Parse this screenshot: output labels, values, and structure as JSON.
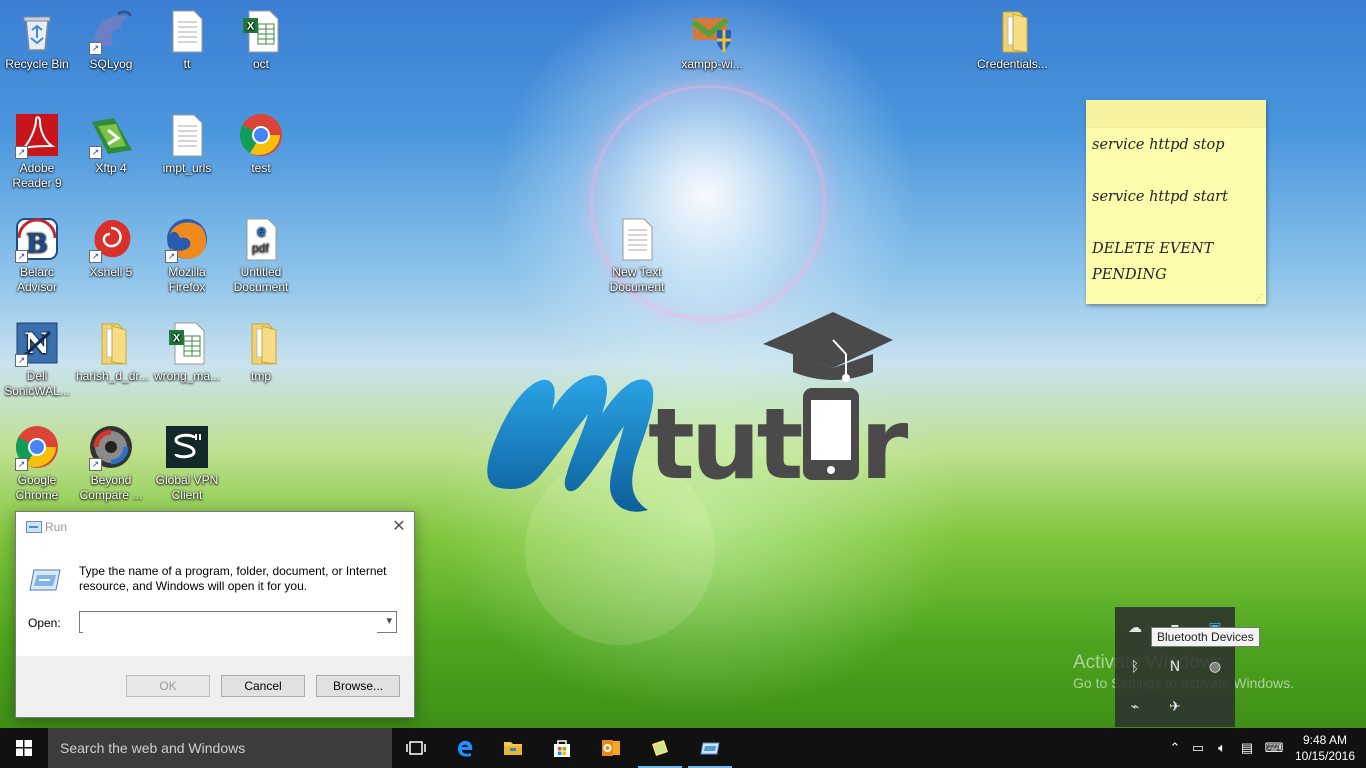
{
  "desktop_icons": [
    {
      "label": "Recycle Bin",
      "icon": "recycle-bin-icon"
    },
    {
      "label": "SQLyog",
      "icon": "sqlyog-icon"
    },
    {
      "label": "tt",
      "icon": "text-file-icon"
    },
    {
      "label": "oct",
      "icon": "excel-file-icon"
    },
    {
      "label": "xampp-wi...",
      "icon": "installer-icon"
    },
    {
      "label": "Credentials...",
      "icon": "folder-icon"
    },
    {
      "label": "Adobe Reader 9",
      "icon": "adobe-reader-icon"
    },
    {
      "label": "Xftp 4",
      "icon": "xftp-icon"
    },
    {
      "label": "impt_urls",
      "icon": "text-file-icon"
    },
    {
      "label": "test",
      "icon": "chrome-icon"
    },
    {
      "label": "Belarc Advisor",
      "icon": "belarc-icon"
    },
    {
      "label": "Xshell 5",
      "icon": "xshell-icon"
    },
    {
      "label": "Mozilla Firefox",
      "icon": "firefox-icon"
    },
    {
      "label": "Untitled Document",
      "icon": "pdf-file-icon"
    },
    {
      "label": "New Text Document",
      "icon": "text-file-icon"
    },
    {
      "label": "Dell SonicWAL...",
      "icon": "sonicwall-icon"
    },
    {
      "label": "harish_d_dr...",
      "icon": "folder-icon"
    },
    {
      "label": "wrong_ma...",
      "icon": "excel-file-icon"
    },
    {
      "label": "tmp",
      "icon": "folder-icon"
    },
    {
      "label": "Google Chrome",
      "icon": "chrome-icon"
    },
    {
      "label": "Beyond Compare ...",
      "icon": "beyond-compare-icon"
    },
    {
      "label": "Global VPN Client",
      "icon": "vpn-client-icon"
    }
  ],
  "wallpaper_logo": {
    "text": "Mtutor",
    "colors": {
      "m": "#1f8fd0",
      "rest": "#4a4a4a"
    }
  },
  "sticky_note": {
    "lines": [
      "service httpd stop",
      "service httpd start",
      "DELETE EVENT",
      "PENDING"
    ],
    "color": "#fdfdad"
  },
  "run_dialog": {
    "title": "Run",
    "description": "Type the name of a program, folder, document, or Internet resource, and Windows will open it for you.",
    "open_label": "Open:",
    "open_value": "",
    "ok_label": "OK",
    "cancel_label": "Cancel",
    "browse_label": "Browse...",
    "close_symbol": "✕"
  },
  "tray_overflow": {
    "tooltip": "Bluetooth Devices",
    "icons": [
      "onedrive-icon",
      "display-icon",
      "network-adapter-icon",
      "bluetooth-icon",
      "sonicwall-tray-icon",
      "globe-icon",
      "satellite-icon",
      "airplane-icon"
    ]
  },
  "watermark": {
    "line1": "Activate Windows",
    "line2": "Go to Settings to activate Windows."
  },
  "taskbar": {
    "search_placeholder": "Search the web and Windows",
    "apps": [
      "task-view-icon",
      "edge-icon",
      "file-explorer-icon",
      "store-icon",
      "outlook-icon",
      "sticky-notes-icon",
      "run-icon"
    ],
    "clock_time": "9:48 AM",
    "clock_date": "10/15/2016"
  }
}
